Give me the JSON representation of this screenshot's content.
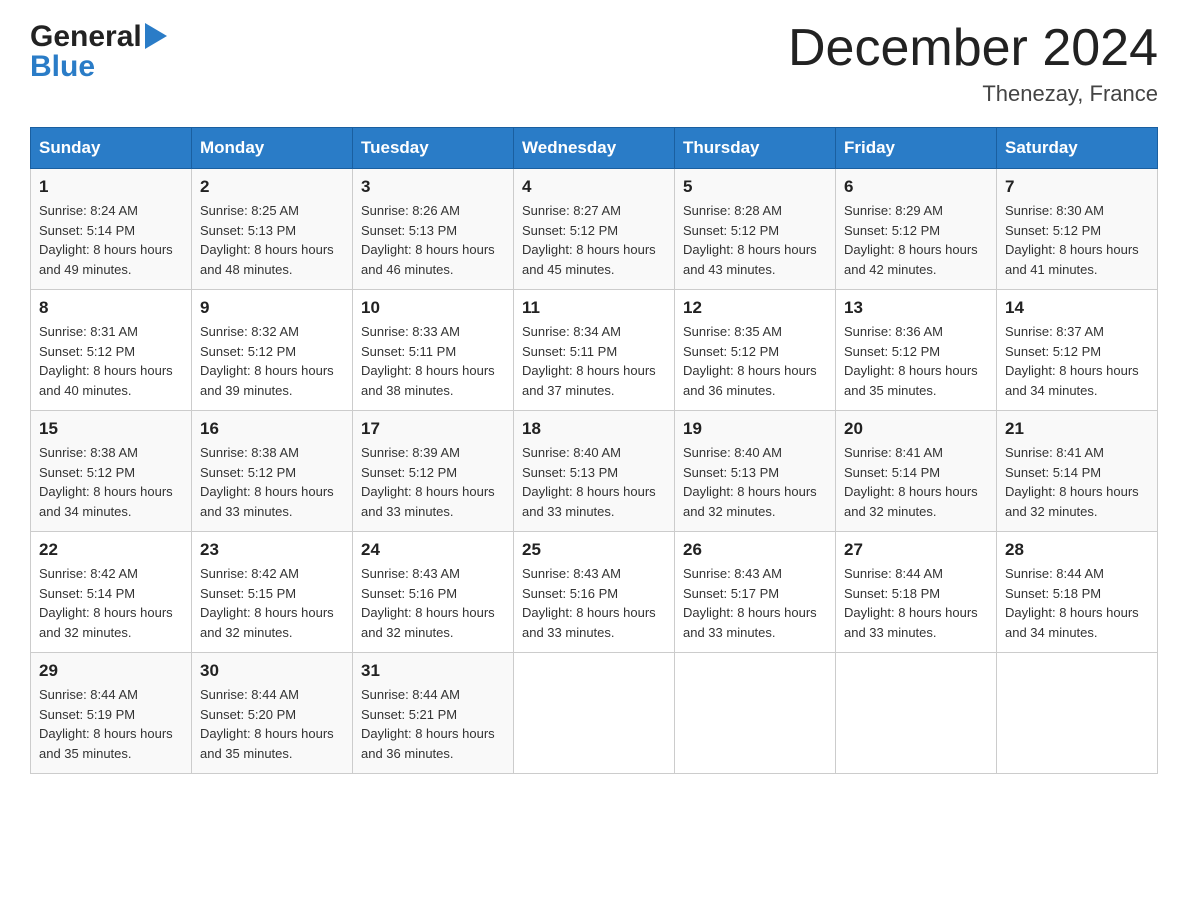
{
  "header": {
    "logo_general": "General",
    "logo_blue": "Blue",
    "title": "December 2024",
    "location": "Thenezay, France"
  },
  "days_of_week": [
    "Sunday",
    "Monday",
    "Tuesday",
    "Wednesday",
    "Thursday",
    "Friday",
    "Saturday"
  ],
  "weeks": [
    [
      {
        "num": "1",
        "sunrise": "8:24 AM",
        "sunset": "5:14 PM",
        "daylight": "8 hours and 49 minutes."
      },
      {
        "num": "2",
        "sunrise": "8:25 AM",
        "sunset": "5:13 PM",
        "daylight": "8 hours and 48 minutes."
      },
      {
        "num": "3",
        "sunrise": "8:26 AM",
        "sunset": "5:13 PM",
        "daylight": "8 hours and 46 minutes."
      },
      {
        "num": "4",
        "sunrise": "8:27 AM",
        "sunset": "5:12 PM",
        "daylight": "8 hours and 45 minutes."
      },
      {
        "num": "5",
        "sunrise": "8:28 AM",
        "sunset": "5:12 PM",
        "daylight": "8 hours and 43 minutes."
      },
      {
        "num": "6",
        "sunrise": "8:29 AM",
        "sunset": "5:12 PM",
        "daylight": "8 hours and 42 minutes."
      },
      {
        "num": "7",
        "sunrise": "8:30 AM",
        "sunset": "5:12 PM",
        "daylight": "8 hours and 41 minutes."
      }
    ],
    [
      {
        "num": "8",
        "sunrise": "8:31 AM",
        "sunset": "5:12 PM",
        "daylight": "8 hours and 40 minutes."
      },
      {
        "num": "9",
        "sunrise": "8:32 AM",
        "sunset": "5:12 PM",
        "daylight": "8 hours and 39 minutes."
      },
      {
        "num": "10",
        "sunrise": "8:33 AM",
        "sunset": "5:11 PM",
        "daylight": "8 hours and 38 minutes."
      },
      {
        "num": "11",
        "sunrise": "8:34 AM",
        "sunset": "5:11 PM",
        "daylight": "8 hours and 37 minutes."
      },
      {
        "num": "12",
        "sunrise": "8:35 AM",
        "sunset": "5:12 PM",
        "daylight": "8 hours and 36 minutes."
      },
      {
        "num": "13",
        "sunrise": "8:36 AM",
        "sunset": "5:12 PM",
        "daylight": "8 hours and 35 minutes."
      },
      {
        "num": "14",
        "sunrise": "8:37 AM",
        "sunset": "5:12 PM",
        "daylight": "8 hours and 34 minutes."
      }
    ],
    [
      {
        "num": "15",
        "sunrise": "8:38 AM",
        "sunset": "5:12 PM",
        "daylight": "8 hours and 34 minutes."
      },
      {
        "num": "16",
        "sunrise": "8:38 AM",
        "sunset": "5:12 PM",
        "daylight": "8 hours and 33 minutes."
      },
      {
        "num": "17",
        "sunrise": "8:39 AM",
        "sunset": "5:12 PM",
        "daylight": "8 hours and 33 minutes."
      },
      {
        "num": "18",
        "sunrise": "8:40 AM",
        "sunset": "5:13 PM",
        "daylight": "8 hours and 33 minutes."
      },
      {
        "num": "19",
        "sunrise": "8:40 AM",
        "sunset": "5:13 PM",
        "daylight": "8 hours and 32 minutes."
      },
      {
        "num": "20",
        "sunrise": "8:41 AM",
        "sunset": "5:14 PM",
        "daylight": "8 hours and 32 minutes."
      },
      {
        "num": "21",
        "sunrise": "8:41 AM",
        "sunset": "5:14 PM",
        "daylight": "8 hours and 32 minutes."
      }
    ],
    [
      {
        "num": "22",
        "sunrise": "8:42 AM",
        "sunset": "5:14 PM",
        "daylight": "8 hours and 32 minutes."
      },
      {
        "num": "23",
        "sunrise": "8:42 AM",
        "sunset": "5:15 PM",
        "daylight": "8 hours and 32 minutes."
      },
      {
        "num": "24",
        "sunrise": "8:43 AM",
        "sunset": "5:16 PM",
        "daylight": "8 hours and 32 minutes."
      },
      {
        "num": "25",
        "sunrise": "8:43 AM",
        "sunset": "5:16 PM",
        "daylight": "8 hours and 33 minutes."
      },
      {
        "num": "26",
        "sunrise": "8:43 AM",
        "sunset": "5:17 PM",
        "daylight": "8 hours and 33 minutes."
      },
      {
        "num": "27",
        "sunrise": "8:44 AM",
        "sunset": "5:18 PM",
        "daylight": "8 hours and 33 minutes."
      },
      {
        "num": "28",
        "sunrise": "8:44 AM",
        "sunset": "5:18 PM",
        "daylight": "8 hours and 34 minutes."
      }
    ],
    [
      {
        "num": "29",
        "sunrise": "8:44 AM",
        "sunset": "5:19 PM",
        "daylight": "8 hours and 35 minutes."
      },
      {
        "num": "30",
        "sunrise": "8:44 AM",
        "sunset": "5:20 PM",
        "daylight": "8 hours and 35 minutes."
      },
      {
        "num": "31",
        "sunrise": "8:44 AM",
        "sunset": "5:21 PM",
        "daylight": "8 hours and 36 minutes."
      },
      null,
      null,
      null,
      null
    ]
  ],
  "colors": {
    "header_bg": "#2a7cc7",
    "header_text": "#ffffff",
    "logo_blue": "#1a6aab"
  }
}
